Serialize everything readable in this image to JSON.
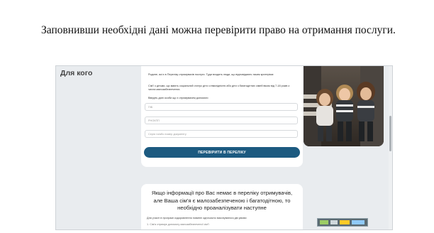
{
  "document": {
    "paragraph": "Заповнивши необхідні дані можна перевірити право на отримання послуги."
  },
  "screenshot": {
    "page_title": "Для кого",
    "intro_line1": "Родине, які є в Переліку отримувачів послуги. Туди входять люди, що відповідають таким критеріям:",
    "intro_line2": "Сім'ї з дітьми, що мають соціальний статус дітя з інвалідністю або діти з багатодітних сімей віком від 7-18 років з числа малозабезпечених.",
    "enter_label": "Введіть дані особи що є отримувачем допомоги",
    "fields": {
      "pib_placeholder": "ПІБ",
      "rnokpp_placeholder": "РНОКПП",
      "doc_placeholder": "Серія та/або номер документу"
    },
    "check_button": "ПЕРЕВІРИТИ В ПЕРЕЛІКУ",
    "second_card": {
      "headline": "Якщо інформації про Вас немає в переліку отримувачів, але Ваша сім'я є малозабезпеченою і багатодітною, то необхідно проаналізувати наступне",
      "sub": "Для участі в програмі оздоровлення повинні одночасно виконуватися дві умови:",
      "sub2": "1. Сім'я отримує допомогу малозабезпеченої сім'ї"
    },
    "colors": {
      "button": "#1c5a80",
      "background": "#e9ecef"
    }
  }
}
